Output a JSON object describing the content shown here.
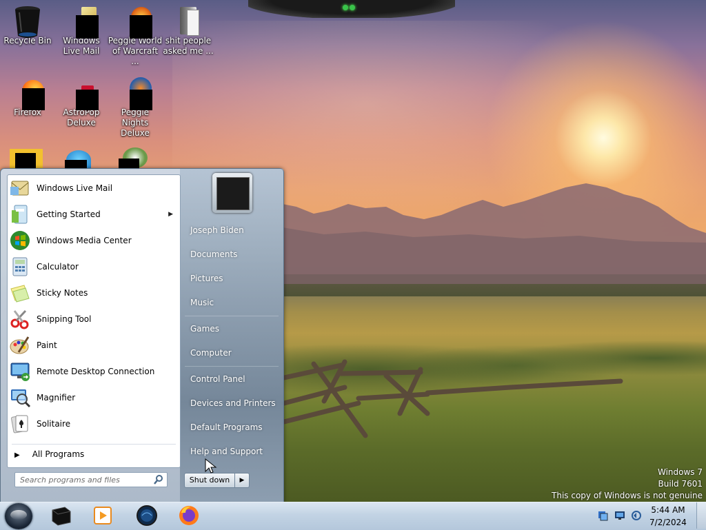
{
  "desktop": {
    "icons": [
      {
        "label": "Recycle Bin",
        "icon": "recycle-bin-icon"
      },
      {
        "label": "Windows Live Mail",
        "icon": "windows-live-mail-icon"
      },
      {
        "label": "Peggle World of Warcraft ...",
        "icon": "peggle-wow-icon"
      },
      {
        "label": "shit people asked me ...",
        "icon": "folder-icon"
      },
      {
        "label": "Firefox",
        "icon": "firefox-icon"
      },
      {
        "label": "AstroPop Deluxe",
        "icon": "astropop-icon"
      },
      {
        "label": "Peggle Nights Deluxe",
        "icon": "peggle-nights-icon"
      }
    ]
  },
  "start_menu": {
    "programs": [
      {
        "label": "Windows Live Mail",
        "icon": "windows-live-mail-icon"
      },
      {
        "label": "Getting Started",
        "icon": "getting-started-icon",
        "has_submenu": true
      },
      {
        "label": "Windows Media Center",
        "icon": "windows-media-center-icon"
      },
      {
        "label": "Calculator",
        "icon": "calculator-icon"
      },
      {
        "label": "Sticky Notes",
        "icon": "sticky-notes-icon"
      },
      {
        "label": "Snipping Tool",
        "icon": "snipping-tool-icon"
      },
      {
        "label": "Paint",
        "icon": "paint-icon"
      },
      {
        "label": "Remote Desktop Connection",
        "icon": "remote-desktop-icon"
      },
      {
        "label": "Magnifier",
        "icon": "magnifier-icon"
      },
      {
        "label": "Solitaire",
        "icon": "solitaire-icon"
      }
    ],
    "all_programs_label": "All Programs",
    "search_placeholder": "Search programs and files",
    "links": [
      {
        "label": "Joseph Biden"
      },
      {
        "label": "Documents"
      },
      {
        "label": "Pictures"
      },
      {
        "label": "Music"
      },
      {
        "label": "Games"
      },
      {
        "label": "Computer"
      },
      {
        "label": "Control Panel"
      },
      {
        "label": "Devices and Printers"
      },
      {
        "label": "Default Programs"
      },
      {
        "label": "Help and Support"
      }
    ],
    "shutdown_label": "Shut down"
  },
  "watermark": {
    "line1": "Windows 7",
    "line2": "Build 7601",
    "line3": "This copy of Windows is not genuine"
  },
  "taskbar": {
    "pinned": [
      {
        "icon": "black-app-icon"
      },
      {
        "icon": "media-player-icon"
      },
      {
        "icon": "globe-app-icon"
      },
      {
        "icon": "firefox-icon"
      }
    ],
    "tray": [
      {
        "icon": "network-tray-icon"
      },
      {
        "icon": "display-tray-icon"
      },
      {
        "icon": "volume-tray-icon"
      }
    ],
    "time": "5:44 AM",
    "date": "7/2/2024"
  }
}
